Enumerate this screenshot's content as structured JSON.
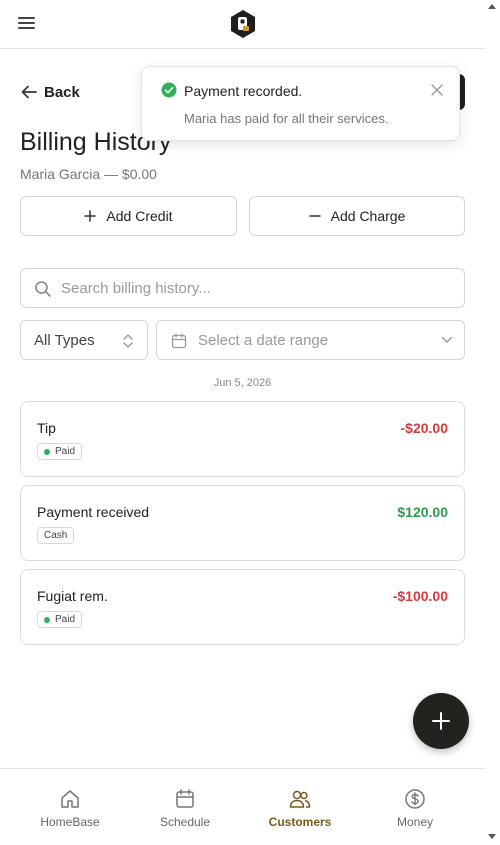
{
  "header": {
    "logo_icon": "brand-logo-icon",
    "menu_icon": "hamburger-menu-icon"
  },
  "nav": {
    "back_label": "Back"
  },
  "page": {
    "title": "Billing History",
    "subtitle": "Maria Garcia — $0.00"
  },
  "actions": {
    "add_credit_label": "Add Credit",
    "add_charge_label": "Add Charge"
  },
  "search": {
    "placeholder": "Search billing history..."
  },
  "filters": {
    "type_value": "All Types",
    "date_placeholder": "Select a date range"
  },
  "history": {
    "date_group": "Jun 5, 2026",
    "entries": [
      {
        "title": "Tip",
        "amount": "-$20.00",
        "badge": "Paid",
        "kind": "charge"
      },
      {
        "title": "Payment received",
        "amount": "$120.00",
        "badge": "Cash",
        "kind": "payment"
      },
      {
        "title": "Fugiat rem.",
        "amount": "-$100.00",
        "badge": "Paid",
        "kind": "charge"
      }
    ]
  },
  "bottom_nav": {
    "items": [
      {
        "label": "HomeBase",
        "icon": "home-icon"
      },
      {
        "label": "Schedule",
        "icon": "calendar-icon"
      },
      {
        "label": "Customers",
        "icon": "users-icon",
        "active": true
      },
      {
        "label": "Money",
        "icon": "dollar-circle-icon"
      }
    ]
  },
  "toast": {
    "title": "Payment recorded.",
    "description": "Maria has paid for all their services."
  },
  "colors": {
    "accent": "#7a5a1a",
    "negative": "#d63a3a",
    "positive": "#2f9a4f",
    "success": "#2db25a",
    "dark": "#24221f"
  }
}
